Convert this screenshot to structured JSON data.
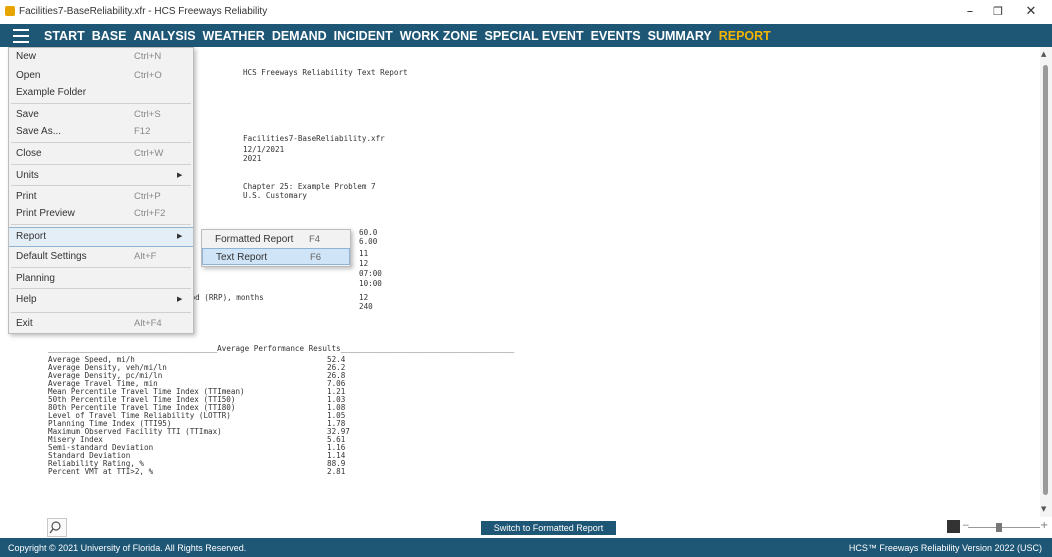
{
  "window": {
    "title": "Facilities7-BaseReliability.xfr - HCS Freeways Reliability",
    "minimize": "–",
    "maximize": "❐",
    "close": "✕"
  },
  "menubar": {
    "items": [
      "START",
      "BASE",
      "ANALYSIS",
      "WEATHER",
      "DEMAND",
      "INCIDENT",
      "WORK ZONE",
      "SPECIAL EVENT",
      "EVENTS",
      "SUMMARY",
      "REPORT"
    ],
    "active": "REPORT",
    "active_color": "#f2b400",
    "bar_color": "#1e5675"
  },
  "file_menu": {
    "items": [
      {
        "label": "New",
        "shortcut": "Ctrl+N"
      },
      {
        "label": "Open",
        "shortcut": "Ctrl+O"
      },
      {
        "label": "Example Folder",
        "shortcut": ""
      },
      {
        "label": "Save",
        "shortcut": "Ctrl+S"
      },
      {
        "label": "Save As...",
        "shortcut": "F12"
      },
      {
        "label": "Close",
        "shortcut": "Ctrl+W"
      },
      {
        "label": "Units",
        "shortcut": ""
      },
      {
        "label": "Print",
        "shortcut": "Ctrl+P"
      },
      {
        "label": "Print Preview",
        "shortcut": "Ctrl+F2"
      },
      {
        "label": "Report",
        "shortcut": ""
      },
      {
        "label": "Default Settings",
        "shortcut": "Alt+F"
      },
      {
        "label": "Planning",
        "shortcut": ""
      },
      {
        "label": "Help",
        "shortcut": ""
      },
      {
        "label": "Exit",
        "shortcut": "Alt+F4"
      }
    ]
  },
  "report_submenu": {
    "items": [
      {
        "label": "Formatted Report",
        "shortcut": "F4"
      },
      {
        "label": "Text Report",
        "shortcut": "F6"
      }
    ]
  },
  "report": {
    "title": "HCS Freeways Reliability Text Report",
    "filename": "Facilities7-BaseReliability.xfr",
    "date": "12/1/2021",
    "year": "2021",
    "description": "Chapter 25: Example Problem 7",
    "units": "U.S. Customary",
    "params": [
      {
        "label": "",
        "value": "60.0"
      },
      {
        "label": "",
        "value": "6.00"
      },
      {
        "label": "",
        "value": "11"
      },
      {
        "label": "s",
        "value": "12"
      },
      {
        "label": "",
        "value": "07:00"
      },
      {
        "label": "",
        "value": "10:00"
      },
      {
        "label": "iod (RRP), months",
        "value": "12"
      },
      {
        "label": "",
        "value": "240"
      }
    ],
    "results_header": "Average Performance Results",
    "results": [
      {
        "label": "Average Speed, mi/h",
        "value": "52.4"
      },
      {
        "label": "Average Density, veh/mi/ln",
        "value": "26.2"
      },
      {
        "label": "Average Density, pc/mi/ln",
        "value": "26.8"
      },
      {
        "label": "Average Travel Time, min",
        "value": "7.06"
      },
      {
        "label": "Mean Percentile Travel Time Index (TTImean)",
        "value": "1.21"
      },
      {
        "label": "50th Percentile Travel Time Index (TTI50)",
        "value": "1.03"
      },
      {
        "label": "80th Percentile Travel Time Index (TTI80)",
        "value": "1.08"
      },
      {
        "label": "Level of Travel Time Reliability (LOTTR)",
        "value": "1.05"
      },
      {
        "label": "Planning Time Index (TTI95)",
        "value": "1.78"
      },
      {
        "label": "Maximum Observed Facility TTI (TTImax)",
        "value": "32.97"
      },
      {
        "label": "Misery Index",
        "value": "5.61"
      },
      {
        "label": "Semi-standard Deviation",
        "value": "1.16"
      },
      {
        "label": "Standard Deviation",
        "value": "1.14"
      },
      {
        "label": "Reliability Rating, %",
        "value": "88.9"
      },
      {
        "label": "Percent VMT at TTI>2, %",
        "value": "2.81"
      }
    ]
  },
  "bottom": {
    "switch_label": "Switch to Formatted Report",
    "search_icon": "magnifier-icon",
    "zoom_icon": "zoom-icon",
    "zoom_minus": "−",
    "zoom_plus": "+"
  },
  "status": {
    "copyright": "Copyright © 2021 University of Florida. All Rights Reserved.",
    "version": "HCS™ Freeways Reliability Version 2022 (USC)"
  }
}
